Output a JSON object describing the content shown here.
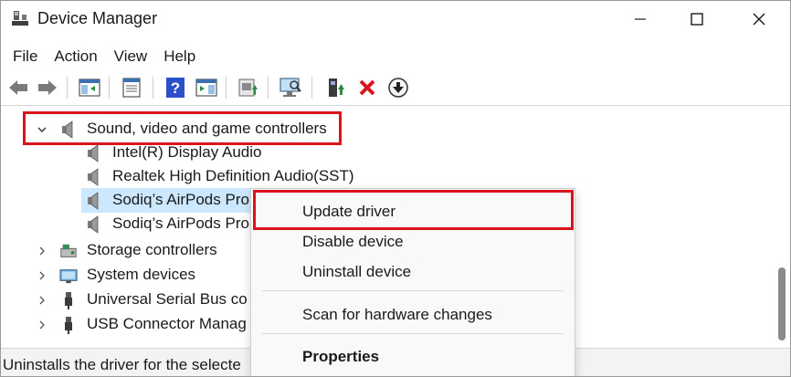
{
  "window": {
    "title": "Device Manager"
  },
  "menu": [
    "File",
    "Action",
    "View",
    "Help"
  ],
  "toolbar": {
    "icons": [
      "back-arrow-icon",
      "forward-arrow-icon",
      "show-hide-console-tree-icon",
      "properties-icon",
      "help-icon",
      "action-pane-icon",
      "update-driver-icon",
      "scan-hardware-icon",
      "enable-device-icon",
      "uninstall-device-icon",
      "disable-device-icon"
    ],
    "colors": {
      "uninstall": "#d9141c",
      "highlight": "#d9141c",
      "selection": "#cce8ff"
    }
  },
  "tree": {
    "category": {
      "label": "Sound, video and game controllers",
      "expanded": true
    },
    "children": [
      {
        "label": "Intel(R) Display Audio"
      },
      {
        "label": "Realtek High Definition Audio(SST)"
      },
      {
        "label": "Sodiq’s AirPods Pro",
        "selected": true
      },
      {
        "label": "Sodiq’s AirPods Pro"
      }
    ],
    "collapsed": [
      {
        "label": "Storage controllers",
        "icon": "storage-controller-icon"
      },
      {
        "label": "System devices",
        "icon": "system-devices-icon"
      },
      {
        "label": "Universal Serial Bus co",
        "icon": "usb-plug-icon"
      },
      {
        "label": "USB Connector Manag",
        "icon": "usb-plug-icon"
      }
    ]
  },
  "context_menu": {
    "items": [
      "Update driver",
      "Disable device",
      "Uninstall device",
      "Scan for hardware changes",
      "Properties"
    ]
  },
  "status": {
    "text": "Uninstalls the driver for the selecte"
  }
}
